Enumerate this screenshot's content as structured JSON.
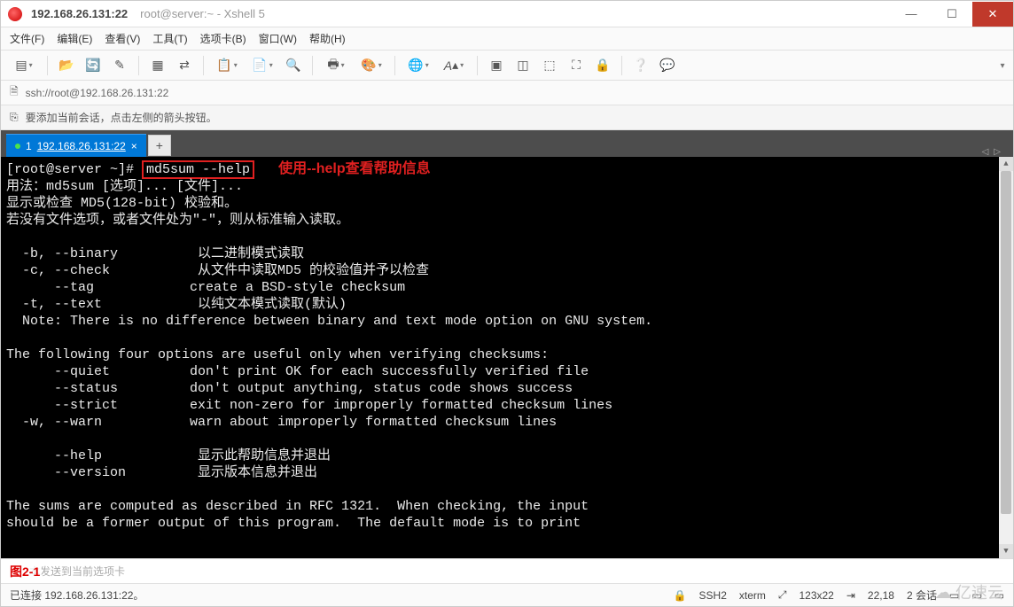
{
  "titlebar": {
    "host": "192.168.26.131:22",
    "app_title": "root@server:~ - Xshell 5"
  },
  "menus": [
    "文件(F)",
    "编辑(E)",
    "查看(V)",
    "工具(T)",
    "选项卡(B)",
    "窗口(W)",
    "帮助(H)"
  ],
  "address": {
    "url": "ssh://root@192.168.26.131:22"
  },
  "hint": {
    "icon_name": "add-session-hint-icon",
    "text": "要添加当前会话，点击左侧的箭头按钮。"
  },
  "tab": {
    "index": "1",
    "label": "192.168.26.131:22"
  },
  "terminal": {
    "prompt": "[root@server ~]# ",
    "command": "md5sum --help",
    "annotation": "使用--help查看帮助信息",
    "lines": [
      "用法：md5sum [选项]... [文件]...",
      "显示或检查 MD5(128-bit) 校验和。",
      "若没有文件选项，或者文件处为\"-\"，则从标准输入读取。",
      "",
      "  -b, --binary          以二进制模式读取",
      "  -c, --check           从文件中读取MD5 的校验值并予以检查",
      "      --tag            create a BSD-style checksum",
      "  -t, --text            以纯文本模式读取(默认)",
      "  Note: There is no difference between binary and text mode option on GNU system.",
      "",
      "The following four options are useful only when verifying checksums:",
      "      --quiet          don't print OK for each successfully verified file",
      "      --status         don't output anything, status code shows success",
      "      --strict         exit non-zero for improperly formatted checksum lines",
      "  -w, --warn           warn about improperly formatted checksum lines",
      "",
      "      --help            显示此帮助信息并退出",
      "      --version         显示版本信息并退出",
      "",
      "The sums are computed as described in RFC 1321.  When checking, the input",
      "should be a former output of this program.  The default mode is to print"
    ]
  },
  "figure_label": "图2-1",
  "sendbar_hint": "本发送到当前选项卡",
  "status": {
    "connected": "已连接 192.168.26.131:22。",
    "proto": "SSH2",
    "term": "xterm",
    "size": "123x22",
    "cursor": "22,18",
    "sessions": "2 会话"
  },
  "watermark": "亿速云",
  "icons": {
    "lock": "🔒",
    "size_pre": "⤢",
    "cursor_pre": "⇥",
    "doc": "🗎"
  }
}
